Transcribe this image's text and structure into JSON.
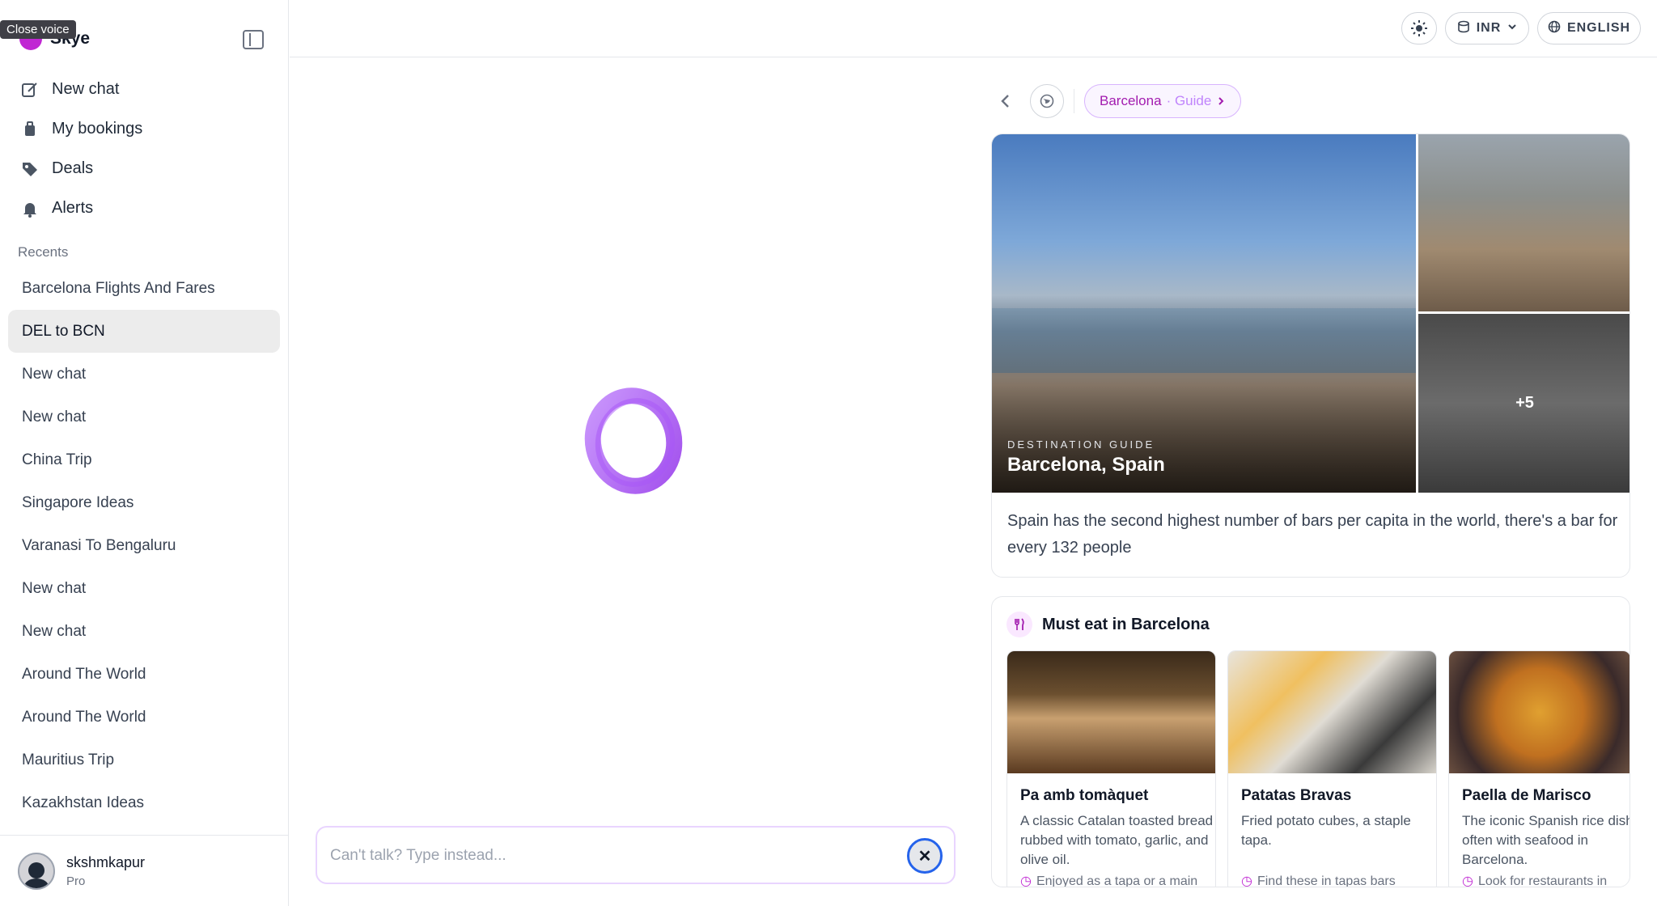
{
  "tooltip": "Close voice",
  "brand": {
    "name": "Skye"
  },
  "nav": [
    {
      "label": "New chat",
      "icon": "edit-icon"
    },
    {
      "label": "My bookings",
      "icon": "luggage-icon"
    },
    {
      "label": "Deals",
      "icon": "tag-icon"
    },
    {
      "label": "Alerts",
      "icon": "bell-icon"
    }
  ],
  "recents": {
    "label": "Recents",
    "items": [
      "Barcelona Flights And Fares",
      "DEL to BCN",
      "New chat",
      "New chat",
      "China Trip",
      "Singapore Ideas",
      "Varanasi To Bengaluru",
      "New chat",
      "New chat",
      "Around The World",
      "Around The World",
      "Mauritius Trip",
      "Kazakhstan Ideas"
    ],
    "active_index": 1
  },
  "user": {
    "name": "skshmkapur",
    "plan": "Pro"
  },
  "topbar": {
    "currency": "INR",
    "language": "ENGLISH"
  },
  "voice": {
    "placeholder": "Can't talk? Type instead..."
  },
  "panel": {
    "crumb_city": "Barcelona",
    "crumb_type": "· Guide",
    "guide": {
      "label": "DESTINATION GUIDE",
      "title": "Barcelona, Spain",
      "more_photos": "+5",
      "fact": "Spain has the second highest number of bars per capita in the world, there's a bar for every 132 people"
    },
    "eat": {
      "title": "Must eat in Barcelona",
      "dishes": [
        {
          "name": "Pa amb tomàquet",
          "desc": "A classic Catalan toasted bread rubbed with tomato, garlic, and olive oil.",
          "tip": "Enjoyed as a tapa or a main"
        },
        {
          "name": "Patatas Bravas",
          "desc": "Fried potato cubes, a staple tapa.",
          "tip": "Find these in tapas bars across the city, often"
        },
        {
          "name": "Paella de Marisco",
          "desc": "The iconic Spanish rice dish often with seafood in Barcelona.",
          "tip": "Look for restaurants in"
        }
      ]
    }
  },
  "colors": {
    "accent": "#a21caf",
    "accent_light": "#faf5ff",
    "focus_ring": "#2563eb"
  }
}
